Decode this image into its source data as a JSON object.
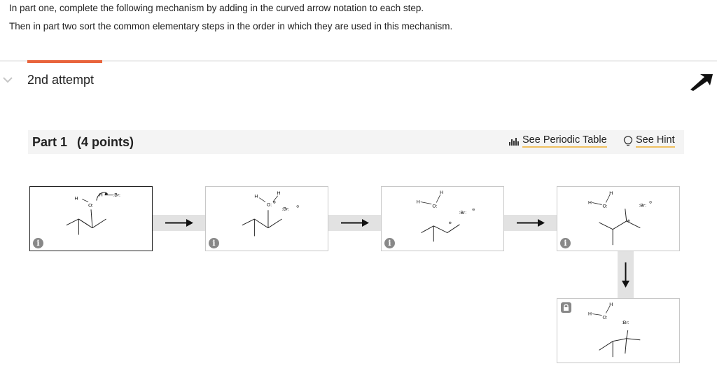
{
  "instructions": {
    "line1": "In part one, complete the following mechanism by adding in the curved arrow notation to each step.",
    "line2": "Then in part two sort the common elementary steps in the order in which they are used in this mechanism."
  },
  "attempt": {
    "label": "2nd attempt"
  },
  "part": {
    "title": "Part 1",
    "points": "(4 points)",
    "periodic_label": "See Periodic Table",
    "hint_label": "See Hint"
  },
  "icons": {
    "collapse": "chevron-down-icon",
    "cursor": "pointer-arrow-icon",
    "periodic": "bar-chart-icon",
    "hint": "lightbulb-icon",
    "info": "info-icon",
    "lock": "lock-icon",
    "step_arrow": "right-arrow-icon",
    "down_arrow": "down-arrow-icon"
  },
  "info_glyph": "i",
  "molecules": {
    "h": "H",
    "o": "O",
    "br": "Br",
    "o_lp": "O:",
    "br_lp": ":Br:",
    "minus": "⊖",
    "plus": "⊕"
  },
  "colors": {
    "accent": "#e8643c",
    "link_underline": "#f0c060",
    "connector": "#e2e2e2"
  }
}
